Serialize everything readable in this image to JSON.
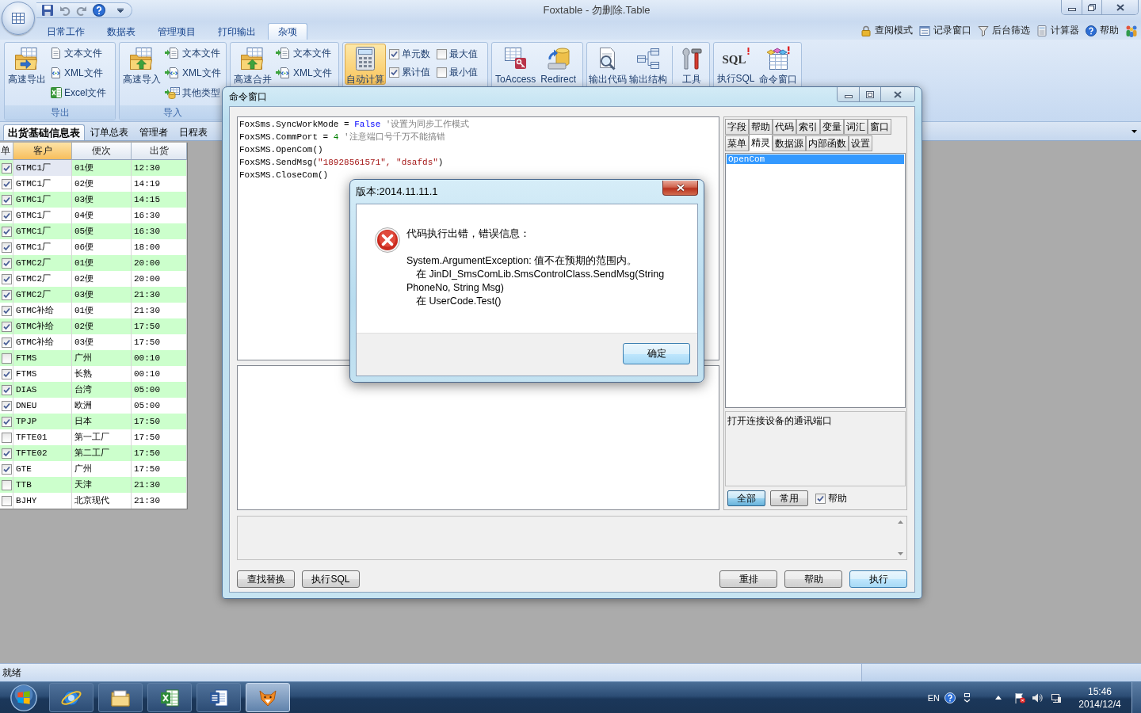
{
  "title_bar": {
    "title": "Foxtable - 勿删除.Table"
  },
  "ribbon": {
    "tabs": [
      {
        "label": "日常工作",
        "selected": false
      },
      {
        "label": "数据表",
        "selected": false
      },
      {
        "label": "管理项目",
        "selected": false
      },
      {
        "label": "打印输出",
        "selected": false
      },
      {
        "label": "杂项",
        "selected": true
      }
    ],
    "quick_links": [
      {
        "label": "查阅模式",
        "kind": "lock"
      },
      {
        "label": "记录窗口",
        "kind": "window"
      },
      {
        "label": "后台筛选",
        "kind": "filter"
      },
      {
        "label": "计算器",
        "kind": "calculator"
      },
      {
        "label": "帮助",
        "kind": "help"
      }
    ],
    "groups": [
      {
        "label": "导出",
        "big_buttons": [
          {
            "label": "高速导出",
            "kind": "export",
            "active": false
          }
        ],
        "small_buttons": [
          {
            "label": "文本文件",
            "kind": "text"
          },
          {
            "label": "XML文件",
            "kind": "xml"
          },
          {
            "label": "Excel文件",
            "kind": "excel"
          }
        ]
      },
      {
        "label": "导入",
        "big_buttons": [
          {
            "label": "高速导入",
            "kind": "import",
            "active": false
          }
        ],
        "small_buttons": [
          {
            "label": "文本文件",
            "kind": "text-in"
          },
          {
            "label": "XML文件",
            "kind": "xml-in"
          },
          {
            "label": "其他类型",
            "kind": "other-in"
          }
        ]
      },
      {
        "big_buttons": [
          {
            "label": "高速合并",
            "kind": "import",
            "active": false
          }
        ],
        "small_buttons": [
          {
            "label": "文本文件",
            "kind": "text-in"
          },
          {
            "label": "XML文件",
            "kind": "xml-in"
          }
        ]
      },
      {
        "big_buttons": [
          {
            "label": "自动计算",
            "kind": "calc",
            "active": true
          }
        ],
        "checkboxes": [
          {
            "label": "单元数",
            "checked": true
          },
          {
            "label": "累计值",
            "checked": true
          },
          {
            "label": "最大值",
            "checked": false
          },
          {
            "label": "最小值",
            "checked": false
          }
        ]
      },
      {
        "big_buttons": [
          {
            "label": "ToAccess",
            "kind": "access",
            "active": false
          },
          {
            "label": "Redirect",
            "kind": "redirect",
            "active": false
          }
        ]
      },
      {
        "big_buttons": [
          {
            "label": "输出代码",
            "kind": "code",
            "active": false
          },
          {
            "label": "输出结构",
            "kind": "structure",
            "active": false
          },
          {
            "label": "工具",
            "kind": "tools",
            "active": false
          }
        ]
      },
      {
        "big_buttons": [
          {
            "label": "执行SQL",
            "kind": "sql",
            "active": false,
            "icon_text": "SQL"
          },
          {
            "label": "命令窗口",
            "kind": "command",
            "active": false
          }
        ]
      }
    ]
  },
  "table_tabs": [
    {
      "label": "出货基础信息表",
      "selected": true
    },
    {
      "label": "订单总表",
      "selected": false
    },
    {
      "label": "管理者",
      "selected": false
    },
    {
      "label": "日程表",
      "selected": false
    }
  ],
  "table": {
    "columns": [
      {
        "label": "单",
        "selected": false
      },
      {
        "label": "客户",
        "selected": true
      },
      {
        "label": "便次",
        "selected": false
      },
      {
        "label": "出货",
        "selected": false
      }
    ],
    "rows": [
      {
        "checked": true,
        "selected": true,
        "customer": "GTMC1厂",
        "trip": "01便",
        "time": "12:30"
      },
      {
        "checked": true,
        "selected": false,
        "customer": "GTMC1厂",
        "trip": "02便",
        "time": "14:19"
      },
      {
        "checked": true,
        "selected": false,
        "customer": "GTMC1厂",
        "trip": "03便",
        "time": "14:15"
      },
      {
        "checked": true,
        "selected": false,
        "customer": "GTMC1厂",
        "trip": "04便",
        "time": "16:30"
      },
      {
        "checked": true,
        "selected": false,
        "customer": "GTMC1厂",
        "trip": "05便",
        "time": "16:30"
      },
      {
        "checked": true,
        "selected": false,
        "customer": "GTMC1厂",
        "trip": "06便",
        "time": "18:00"
      },
      {
        "checked": true,
        "selected": false,
        "customer": "GTMC2厂",
        "trip": "01便",
        "time": "20:00"
      },
      {
        "checked": true,
        "selected": false,
        "customer": "GTMC2厂",
        "trip": "02便",
        "time": "20:00"
      },
      {
        "checked": true,
        "selected": false,
        "customer": "GTMC2厂",
        "trip": "03便",
        "time": "21:30"
      },
      {
        "checked": true,
        "selected": false,
        "customer": "GTMC补给",
        "trip": "01便",
        "time": "21:30"
      },
      {
        "checked": true,
        "selected": false,
        "customer": "GTMC补给",
        "trip": "02便",
        "time": "17:50"
      },
      {
        "checked": true,
        "selected": false,
        "customer": "GTMC补给",
        "trip": "03便",
        "time": "17:50"
      },
      {
        "checked": false,
        "selected": false,
        "customer": "FTMS",
        "trip": "广州",
        "time": "00:10"
      },
      {
        "checked": true,
        "selected": false,
        "customer": "FTMS",
        "trip": "长熟",
        "time": "00:10"
      },
      {
        "checked": true,
        "selected": false,
        "customer": "DIAS",
        "trip": "台湾",
        "time": "05:00"
      },
      {
        "checked": true,
        "selected": false,
        "customer": "DNEU",
        "trip": "欧洲",
        "time": "05:00"
      },
      {
        "checked": true,
        "selected": false,
        "customer": "TPJP",
        "trip": "日本",
        "time": "17:50"
      },
      {
        "checked": false,
        "selected": false,
        "customer": "TFTE01",
        "trip": "第一工厂",
        "time": "17:50"
      },
      {
        "checked": true,
        "selected": false,
        "customer": "TFTE02",
        "trip": "第二工厂",
        "time": "17:50"
      },
      {
        "checked": true,
        "selected": false,
        "customer": "GTE",
        "trip": "广州",
        "time": "17:50"
      },
      {
        "checked": false,
        "selected": false,
        "customer": "TTB",
        "trip": "天津",
        "time": "21:30"
      },
      {
        "checked": false,
        "selected": false,
        "customer": "BJHY",
        "trip": "北京现代",
        "time": "21:30"
      }
    ]
  },
  "status_bar": {
    "text": "就绪"
  },
  "taskbar": {
    "apps": [
      {
        "kind": "browser",
        "active": false
      },
      {
        "kind": "folder",
        "active": false
      },
      {
        "kind": "spreadsheet",
        "active": false
      },
      {
        "kind": "document",
        "active": false
      },
      {
        "kind": "fox",
        "active": true
      }
    ],
    "language": "EN",
    "time": "15:46",
    "date": "2014/12/4"
  },
  "command_window": {
    "title": "命令窗口",
    "code_lines": [
      {
        "tokens": [
          {
            "kind": "plain",
            "text": "FoxSms.SyncWorkMode = "
          },
          {
            "kind": "keyword",
            "text": "False"
          },
          {
            "kind": "comment",
            "text": " '设置为同步工作模式"
          }
        ]
      },
      {
        "tokens": [
          {
            "kind": "plain",
            "text": "FoxSMS.CommPort = "
          },
          {
            "kind": "number",
            "text": "4"
          },
          {
            "kind": "comment",
            "text": " '注意端口号千万不能搞错"
          }
        ]
      },
      {
        "tokens": [
          {
            "kind": "plain",
            "text": "FoxSMS.OpenCom()"
          }
        ]
      },
      {
        "tokens": [
          {
            "kind": "plain",
            "text": "FoxSMS.SendMsg("
          },
          {
            "kind": "string",
            "text": "\"18928561571\", \"dsafds\""
          },
          {
            "kind": "plain",
            "text": ")"
          }
        ]
      },
      {
        "tokens": [
          {
            "kind": "plain",
            "text": "FoxSMS.CloseCom()"
          }
        ]
      }
    ],
    "tab_rows": [
      {
        "tabs": [
          {
            "label": "字段",
            "selected": false
          },
          {
            "label": "帮助",
            "selected": false
          },
          {
            "label": "代码",
            "selected": false
          },
          {
            "label": "索引",
            "selected": false
          },
          {
            "label": "变量",
            "selected": false
          },
          {
            "label": "词汇",
            "selected": false
          },
          {
            "label": "窗口",
            "selected": false
          }
        ]
      },
      {
        "tabs": [
          {
            "label": "菜单",
            "selected": false
          },
          {
            "label": "精灵",
            "selected": true
          },
          {
            "label": "数据源",
            "selected": false
          },
          {
            "label": "内部函数",
            "selected": false
          },
          {
            "label": "设置",
            "selected": false
          }
        ]
      }
    ],
    "list_items": [
      {
        "label": "OpenCom",
        "selected": true
      }
    ],
    "description": "打开连接设备的通讯端口",
    "filter_buttons": [
      {
        "label": "全部",
        "selected": true
      },
      {
        "label": "常用",
        "selected": false
      }
    ],
    "help_option": {
      "label": "帮助",
      "checked": true
    },
    "left_buttons": [
      {
        "label": "查找替换"
      },
      {
        "label": "执行SQL"
      }
    ],
    "right_buttons": [
      {
        "label": "重排",
        "default": false
      },
      {
        "label": "帮助",
        "default": false
      },
      {
        "label": "执行",
        "default": true
      }
    ]
  },
  "dialog": {
    "title": "版本:2014.11.11.1",
    "heading": "代码执行出错，错误信息：",
    "message_lines": [
      {
        "text": "System.ArgumentException: 值不在预期的范围内。",
        "indented": false
      },
      {
        "text": "在 JinDI_SmsComLib.SmsControlClass.SendMsg(String PhoneNo, String Msg)",
        "indented": true
      },
      {
        "text": "在 UserCode.Test()",
        "indented": true
      }
    ],
    "button": "确定"
  }
}
